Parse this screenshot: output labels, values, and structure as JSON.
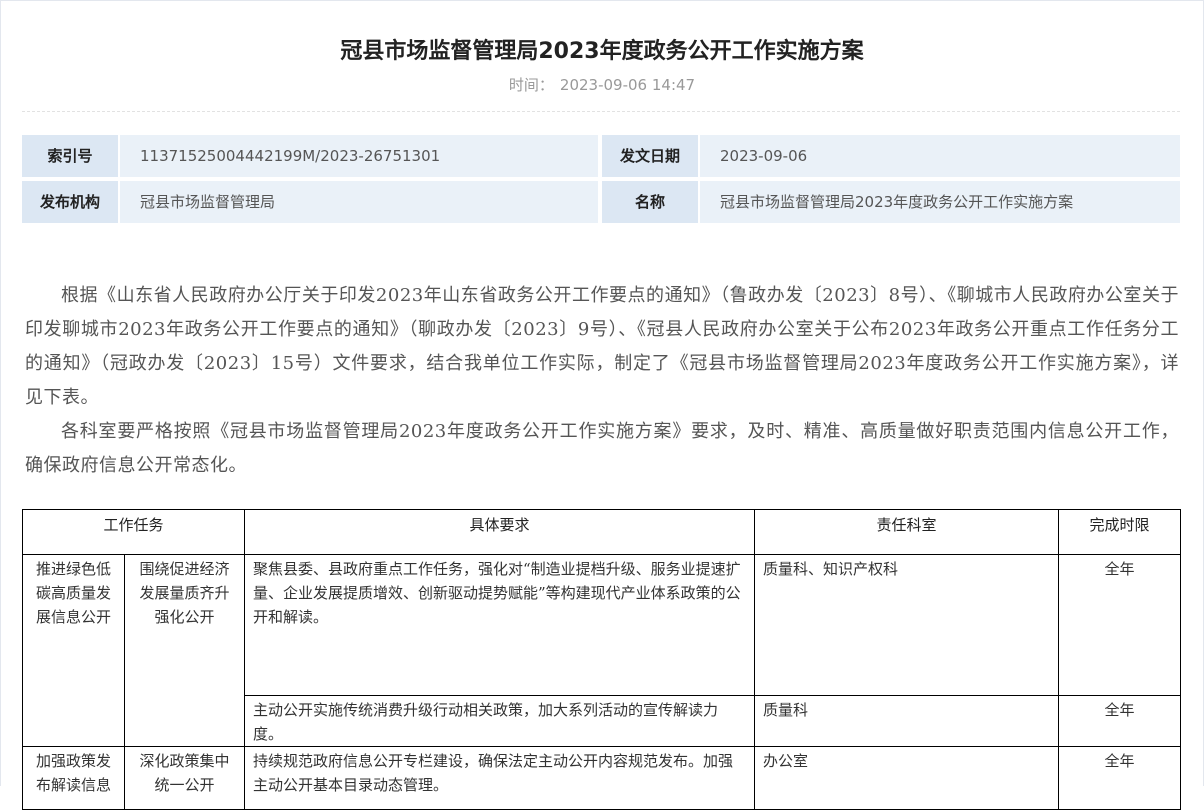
{
  "article": {
    "title": "冠县市场监督管理局2023年度政务公开工作实施方案",
    "time_label": "时间：",
    "time_value": "2023-09-06 14:47"
  },
  "meta": {
    "index_label": "索引号",
    "index_value": "11371525004442199M/2023-26751301",
    "date_label": "发文日期",
    "date_value": "2023-09-06",
    "org_label": "发布机构",
    "org_value": "冠县市场监督管理局",
    "name_label": "名称",
    "name_value": "冠县市场监督管理局2023年度政务公开工作实施方案"
  },
  "body": {
    "p1": "根据《山东省人民政府办公厅关于印发2023年山东省政务公开工作要点的通知》（鲁政办发〔2023〕8号）、《聊城市人民政府办公室关于印发聊城市2023年政务公开工作要点的通知》（聊政办发〔2023〕9号）、《冠县人民政府办公室关于公布2023年政务公开重点工作任务分工的通知》（冠政办发〔2023〕15号）文件要求，结合我单位工作实际，制定了《冠县市场监督管理局2023年度政务公开工作实施方案》，详见下表。",
    "p2": "各科室要严格按照《冠县市场监督管理局2023年度政务公开工作实施方案》要求，及时、精准、高质量做好职责范围内信息公开工作，确保政府信息公开常态化。"
  },
  "table": {
    "headers": [
      "工作任务",
      "具体要求",
      "责任科室",
      "完成时限"
    ],
    "rows": [
      {
        "task": "推进绿色低碳高质量发展信息公开",
        "subtask": "围绕促进经济发展量质齐升强化公开",
        "items": [
          {
            "req": "聚焦县委、县政府重点工作任务，强化对“制造业提档升级、服务业提速扩量、企业发展提质增效、创新驱动提势赋能”等构建现代产业体系政策的公开和解读。",
            "dept": "质量科、知识产权科",
            "deadline": "全年"
          },
          {
            "req": "主动公开实施传统消费升级行动相关政策，加大系列活动的宣传解读力度。",
            "dept": "质量科",
            "deadline": "全年"
          }
        ]
      },
      {
        "task": "加强政策发布解读信息",
        "subtask": "深化政策集中统一公开",
        "items": [
          {
            "req": "持续规范政府信息公开专栏建设，确保法定主动公开内容规范发布。加强主动公开基本目录动态管理。",
            "dept": "办公室",
            "deadline": "全年"
          }
        ]
      }
    ]
  }
}
